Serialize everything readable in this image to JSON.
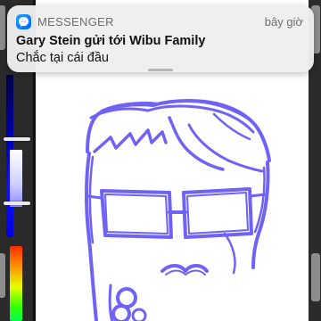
{
  "notification": {
    "app_name": "MESSENGER",
    "timestamp": "bây giờ",
    "title": "Gary Stein gửi tới Wibu Family",
    "body": "Chắc tại cái đầu",
    "app_icon": "messenger-icon",
    "accent_color": "#0a7cff"
  },
  "drawing": {
    "subject": "sketch-face-with-glasses",
    "stroke_color": "#6f62f4",
    "background_color": "#ffffff"
  },
  "toolbar": {
    "hue_slider_color": "#0000ff",
    "lightness_slider_color": "#c8c9ff"
  }
}
